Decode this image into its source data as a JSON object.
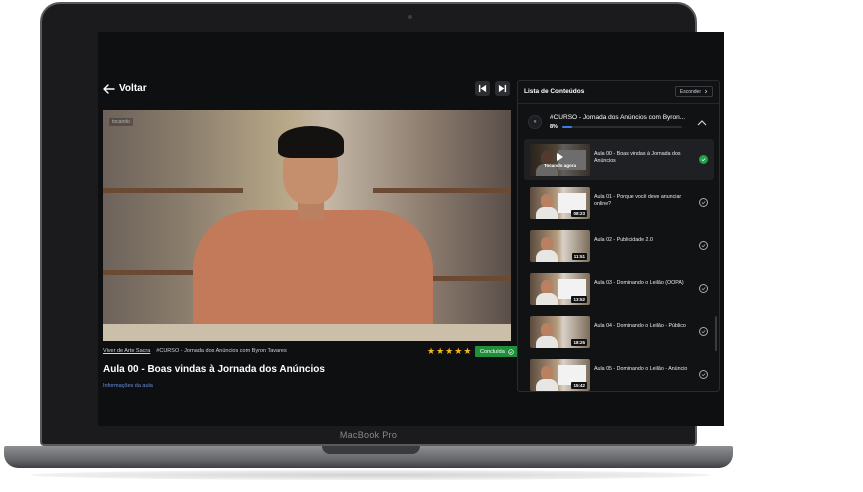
{
  "device": {
    "brand": "MacBook Pro"
  },
  "topbar": {
    "back_label": "Voltar"
  },
  "video": {
    "watermark": "tocando"
  },
  "breadcrumb": {
    "school": "Viver de Arte Sacra",
    "course": "#CURSO - Jornada dos Anúncios com Byron Tavares"
  },
  "rating": {
    "stars": 5
  },
  "status": {
    "done_label": "Concluída"
  },
  "lesson": {
    "title": "Aula 00 - Boas vindas à Jornada dos Anúncios",
    "info_link": "Informações da aula"
  },
  "sidebar": {
    "title": "Lista de Conteúdos",
    "hide_label": "Esconder",
    "course_title": "#CURSO - Jornada dos Anúncios com Byron...",
    "progress_label": "8%",
    "progress_value": 0.08,
    "playing_label": "Tocando agora",
    "lessons": [
      {
        "title": "Aula 00 - Boas vindas à Jornada dos Anúncios",
        "duration": "",
        "completed": true,
        "active": true
      },
      {
        "title": "Aula 01 - Porque você deve anunciar online?",
        "duration": "08:23",
        "completed": false,
        "active": false
      },
      {
        "title": "Aula 02 - Publicidade 2.0",
        "duration": "11:51",
        "completed": false,
        "active": false
      },
      {
        "title": "Aula 03 - Dominando o Leilão (OOPA)",
        "duration": "13:52",
        "completed": false,
        "active": false
      },
      {
        "title": "Aula 04 - Dominando o Leilão - Público",
        "duration": "18:25",
        "completed": false,
        "active": false
      },
      {
        "title": "Aula 05 - Dominando o Leilão - Anúncio",
        "duration": "15:42",
        "completed": false,
        "active": false
      }
    ]
  },
  "colors": {
    "accent": "#3e7be0",
    "success": "#1f8f3a",
    "star": "#f5b81c"
  }
}
